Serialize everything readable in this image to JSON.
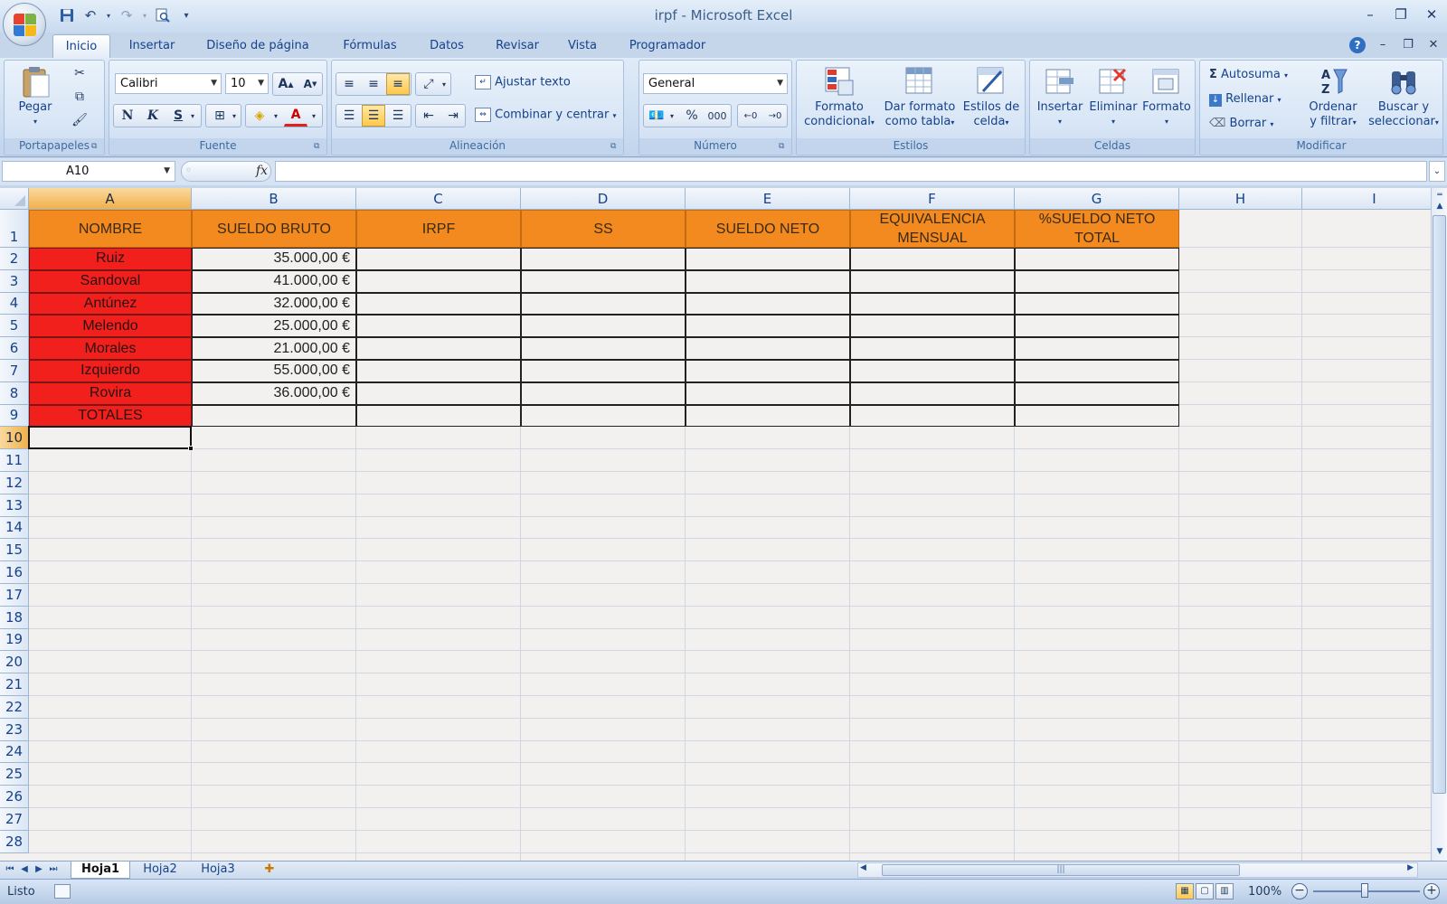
{
  "window": {
    "title": "irpf - Microsoft Excel"
  },
  "qat": {
    "save_icon": "floppy-save-icon",
    "undo_icon": "undo-icon",
    "redo_icon": "redo-icon",
    "print_preview_icon": "print-preview-icon"
  },
  "tabs": [
    {
      "label": "Inicio",
      "active": true
    },
    {
      "label": "Insertar"
    },
    {
      "label": "Diseño de página"
    },
    {
      "label": "Fórmulas"
    },
    {
      "label": "Datos"
    },
    {
      "label": "Revisar"
    },
    {
      "label": "Vista"
    },
    {
      "label": "Programador"
    }
  ],
  "ribbon": {
    "portapapeles": {
      "label": "Portapapeles",
      "paste": "Pegar"
    },
    "fuente": {
      "label": "Fuente",
      "font": "Calibri",
      "size": "10",
      "bold": "N",
      "italic": "K",
      "underline": "S"
    },
    "alineacion": {
      "label": "Alineación",
      "wrap": "Ajustar texto",
      "merge": "Combinar y centrar"
    },
    "numero": {
      "label": "Número",
      "format": "General",
      "percent": "%",
      "thousands": "000"
    },
    "estilos": {
      "label": "Estilos",
      "cond_1": "Formato",
      "cond_2": "condicional",
      "table_1": "Dar formato",
      "table_2": "como tabla",
      "cell_1": "Estilos de",
      "cell_2": "celda"
    },
    "celdas": {
      "label": "Celdas",
      "insert": "Insertar",
      "delete": "Eliminar",
      "format": "Formato"
    },
    "modificar": {
      "label": "Modificar",
      "autosum": "Autosuma",
      "fill": "Rellenar",
      "clear": "Borrar",
      "sort_1": "Ordenar",
      "sort_2": "y filtrar",
      "find_1": "Buscar y",
      "find_2": "seleccionar"
    }
  },
  "formula_bar": {
    "name_box": "A10",
    "fx": "fx",
    "formula": ""
  },
  "columns": [
    "A",
    "B",
    "C",
    "D",
    "E",
    "F",
    "G",
    "H",
    "I"
  ],
  "rows": [
    "1",
    "2",
    "3",
    "4",
    "5",
    "6",
    "7",
    "8",
    "9",
    "10",
    "11",
    "12",
    "13",
    "14",
    "15",
    "16",
    "17",
    "18",
    "19",
    "20",
    "21",
    "22",
    "23",
    "24",
    "25",
    "26",
    "27",
    "28"
  ],
  "sheet": {
    "headers": [
      "NOMBRE",
      "SUELDO BRUTO",
      "IRPF",
      "SS",
      "SUELDO NETO",
      "EQUIVALENCIA MENSUAL",
      "%SUELDO NETO TOTAL"
    ],
    "names": [
      "Ruiz",
      "Sandoval",
      "Antúnez",
      "Melendo",
      "Morales",
      "Izquierdo",
      "Rovira",
      "TOTALES"
    ],
    "sueldo_bruto": [
      "35.000,00 €",
      "41.000,00 €",
      "32.000,00 €",
      "25.000,00 €",
      "21.000,00 €",
      "55.000,00 €",
      "36.000,00 €",
      ""
    ]
  },
  "active_cell": "A10",
  "sheet_tabs": [
    {
      "label": "Hoja1",
      "active": true
    },
    {
      "label": "Hoja2"
    },
    {
      "label": "Hoja3"
    }
  ],
  "status": {
    "text": "Listo",
    "zoom": "100%",
    "zoom_out": "−",
    "zoom_in": "+"
  }
}
